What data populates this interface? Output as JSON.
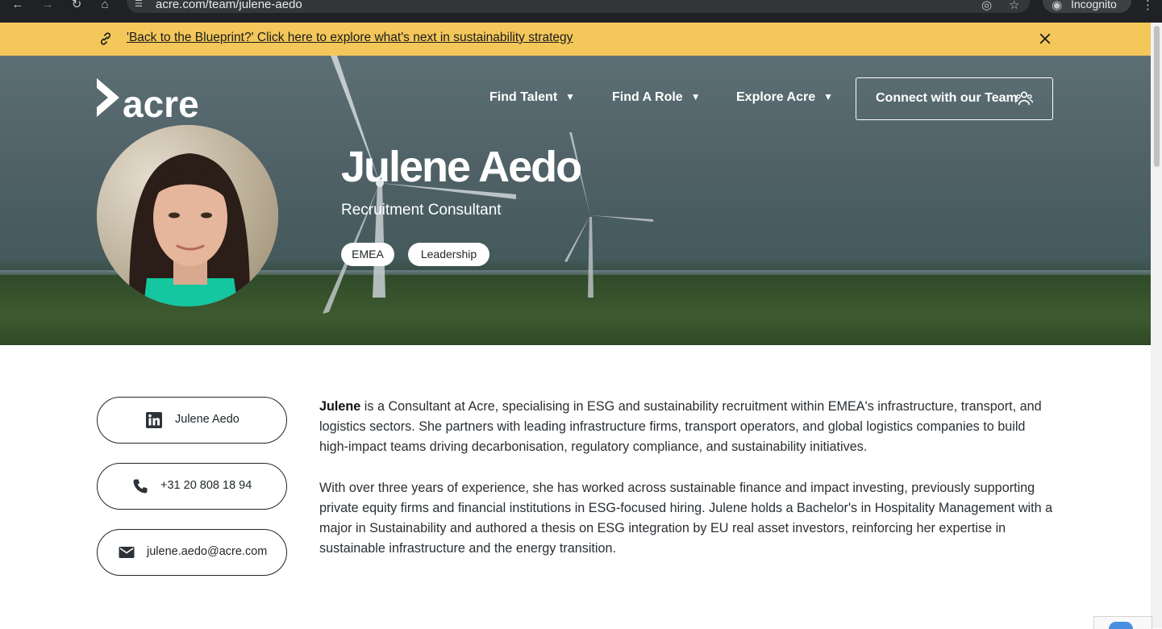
{
  "browser": {
    "url": "acre.com/team/julene-aedo",
    "profile_label": "Incognito"
  },
  "banner": {
    "text": "'Back to the Blueprint?' Click here to explore what's next in sustainability strategy",
    "background": "#f3c75a"
  },
  "header": {
    "logo_text": "acre",
    "nav": [
      {
        "label": "Find Talent"
      },
      {
        "label": "Find A Role"
      },
      {
        "label": "Explore Acre"
      }
    ],
    "cta_label": "Connect with our Team"
  },
  "profile": {
    "name": "Julene Aedo",
    "title": "Recruitment Consultant",
    "tags": [
      "EMEA",
      "Leadership"
    ]
  },
  "contacts": {
    "linkedin": "Julene Aedo",
    "phone": "+31 20 808 18 94",
    "email": "julene.aedo@acre.com"
  },
  "bio": {
    "p1_name": "Julene",
    "p1_rest": " is a Consultant at Acre, specialising in ESG and sustainability recruitment within EMEA's infrastructure, transport, and logistics sectors. She partners with leading infrastructure firms, transport operators, and global logistics companies to build high-impact teams driving decarbonisation, regulatory compliance, and sustainability initiatives.",
    "p2": "With over three years of experience, she has worked across sustainable finance and impact investing, previously supporting private equity firms and financial institutions in ESG-focused hiring. Julene holds a Bachelor's in Hospitality Management with a major in Sustainability and authored a thesis on ESG integration by EU real asset investors, reinforcing her expertise in sustainable infrastructure and the energy transition."
  }
}
